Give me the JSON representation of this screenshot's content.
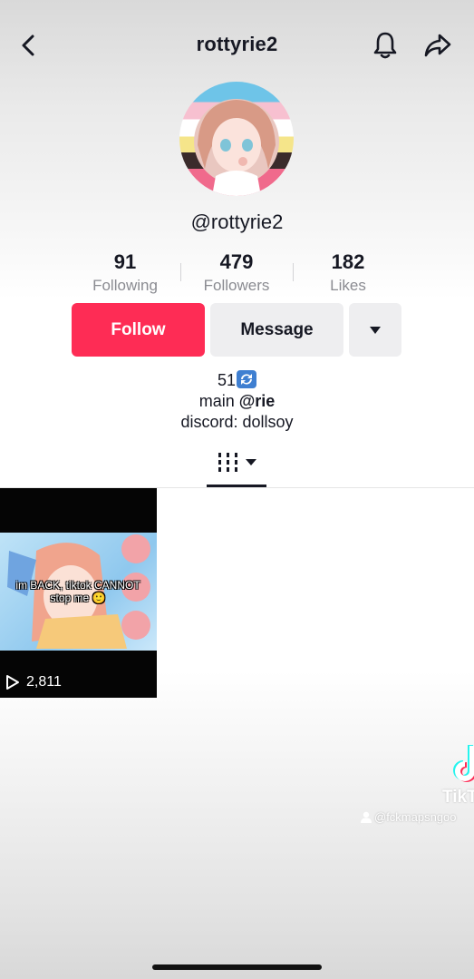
{
  "header": {
    "title": "rottyrie2"
  },
  "profile": {
    "handle": "@rottyrie2",
    "stats": [
      {
        "value": "91",
        "label": "Following"
      },
      {
        "value": "479",
        "label": "Followers"
      },
      {
        "value": "182",
        "label": "Likes"
      }
    ]
  },
  "actions": {
    "follow_label": "Follow",
    "message_label": "Message"
  },
  "bio": {
    "line1": "51",
    "line2_prefix": "main ",
    "line2_mention": "@rie",
    "line3": "discord: dollsoy"
  },
  "videos": [
    {
      "caption": "im BACK, tiktok CANNOT stop me 🙂",
      "views": "2,811"
    }
  ],
  "watermark": {
    "brand": "TikTok",
    "user": "@fckmapsngoo"
  },
  "colors": {
    "follow": "#fe2c55",
    "secondary_button": "#eeeef0"
  }
}
